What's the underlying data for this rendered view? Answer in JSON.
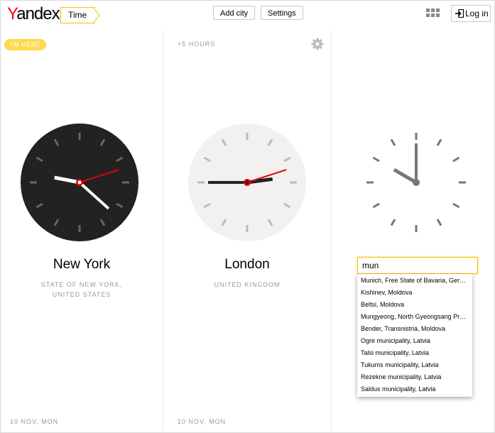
{
  "header": {
    "logo": "Yandex",
    "service": "Time",
    "add_city": "Add city",
    "settings": "Settings",
    "login": "Log in"
  },
  "clocks": [
    {
      "badge": "I'M HERE",
      "city": "New York",
      "region_line1": "STATE OF NEW YORK,",
      "region_line2": "UNITED STATES",
      "date": "10 NOV, MON",
      "time": {
        "h": 9,
        "m": 22,
        "s": 12
      },
      "face_color": "#222222",
      "tick_color": "#666666",
      "hand_color": "#ffffff"
    },
    {
      "offset": "+5 HOURS",
      "city": "London",
      "region_line1": "UNITED KINGDOM",
      "date": "10 NOV, MON",
      "time": {
        "h": 2,
        "m": 45,
        "s": 12
      },
      "face_color": "#f2f1f0",
      "tick_color": "#bbbbbb",
      "hand_color": "#222222"
    },
    {
      "time": {
        "h": 10,
        "m": 0,
        "s": 0
      },
      "face_color": "#ffffff",
      "tick_color": "#777777",
      "hand_color": "#777777"
    }
  ],
  "search": {
    "value": "mun",
    "suggestions": [
      "Munich, Free State of Bavaria, Ger…",
      "Kishinev, Moldova",
      "Beltsi, Moldova",
      "Mungyeong, North Gyeongsang Pr…",
      "Bender, Transnistria, Moldova",
      "Ogre municipality, Latvia",
      "Talsi municipality, Latvia",
      "Tukums municipality, Latvia",
      "Rezekne municipality, Latvia",
      "Saldus municipality, Latvia"
    ]
  },
  "colors": {
    "accent": "#f5c400",
    "logo_red": "#ff0000",
    "second_hand": "#e60000"
  }
}
